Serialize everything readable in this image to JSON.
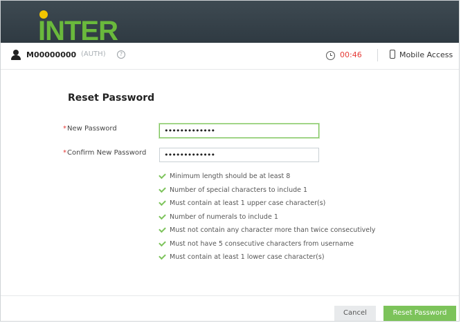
{
  "header": {
    "logo_text": "INTER",
    "colors": {
      "banner": "#34404a",
      "logo": "#6ab93c",
      "dot": "#f2c500"
    }
  },
  "userbar": {
    "user_icon": "user-icon",
    "user_id": "M00000000",
    "auth": "(AUTH)",
    "help_icon": "help-icon",
    "timer": "00:46",
    "timer_color": "#e53935",
    "mobile_icon": "mobile-phone-icon",
    "mobile_label": "Mobile Access"
  },
  "form": {
    "title": "Reset Password",
    "fields": [
      {
        "label": "New Password",
        "required": "*",
        "value": "•••••••••••••"
      },
      {
        "label": "Confirm New Password",
        "required": "*",
        "value": "•••••••••••••"
      }
    ],
    "rules": [
      "Minimum length should be at least 8",
      "Number of special characters to include 1",
      "Must contain at least 1 upper case character(s)",
      "Number of numerals to include 1",
      "Must not contain any character more than twice consecutively",
      "Must not have 5 consecutive characters from username",
      "Must contain at least 1 lower case character(s)"
    ],
    "rule_icon": "check-icon"
  },
  "footer": {
    "cancel_label": "Cancel",
    "submit_label": "Reset Password",
    "accent": "#7cc35a"
  }
}
